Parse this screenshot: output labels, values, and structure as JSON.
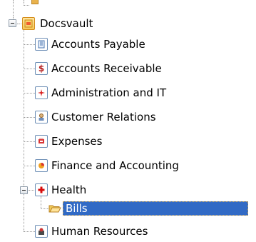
{
  "tree": {
    "root": {
      "label": "Docsvault",
      "expanded": true,
      "icon": "docsvault-icon"
    },
    "items": [
      {
        "label": "Accounts Payable",
        "icon": "accounts-payable-icon"
      },
      {
        "label": "Accounts Receivable",
        "icon": "dollar-icon"
      },
      {
        "label": "Administration and IT",
        "icon": "administration-icon"
      },
      {
        "label": "Customer Relations",
        "icon": "customer-relations-icon"
      },
      {
        "label": "Expenses",
        "icon": "expenses-icon"
      },
      {
        "label": "Finance and Accounting",
        "icon": "finance-icon"
      },
      {
        "label": "Health",
        "icon": "health-cross-icon",
        "expanded": true,
        "children": [
          {
            "label": "Bills",
            "icon": "open-folder-icon",
            "selected": true
          }
        ]
      },
      {
        "label": "Human Resources",
        "icon": "human-resources-icon"
      }
    ]
  },
  "colors": {
    "selection_background": "#316ac5",
    "selection_text": "#ffffff",
    "tree_lines": "#9a9a9a"
  }
}
